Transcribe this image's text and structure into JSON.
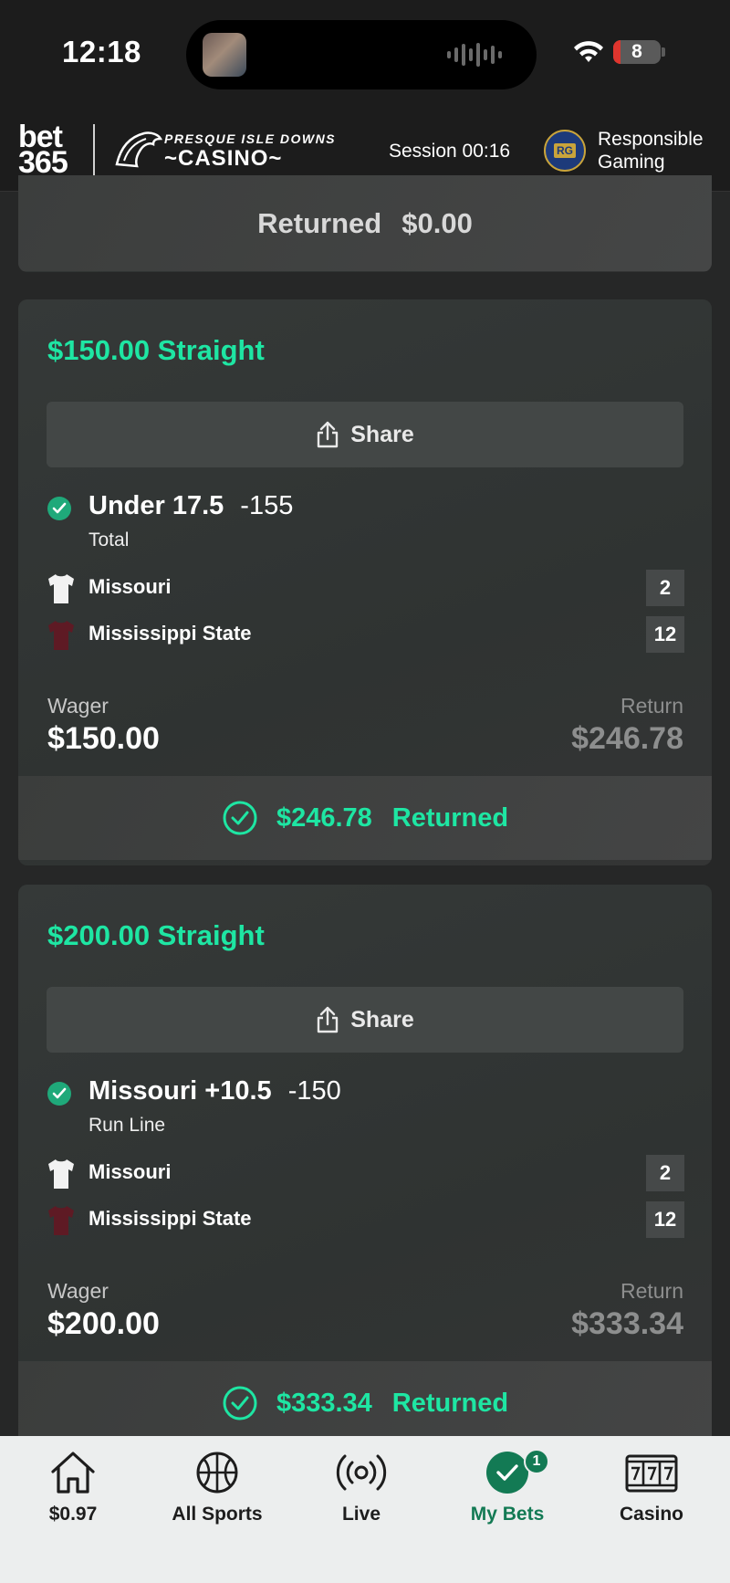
{
  "status_bar": {
    "time": "12:18",
    "battery_level": "8",
    "icons": [
      "wifi-icon",
      "battery-icon",
      "audio-waveform-icon"
    ]
  },
  "header": {
    "brand_line1": "bet",
    "brand_line2": "365",
    "casino_line1": "PRESQUE ISLE DOWNS",
    "casino_line2": "CASINO",
    "session": "Session 00:16",
    "rg_badge": "RG",
    "responsible_line1": "Responsible",
    "responsible_line2": "Gaming"
  },
  "previous_bet": {
    "returned_label": "Returned",
    "returned_amount": "$0.00"
  },
  "bets": [
    {
      "title": "$150.00 Straight",
      "share_label": "Share",
      "selection": "Under 17.5",
      "odds": "-155",
      "market": "Total",
      "teams": [
        {
          "name": "Missouri",
          "score": "2",
          "shirt_color": "#f2f2f2"
        },
        {
          "name": "Mississippi State",
          "score": "12",
          "shirt_color": "#5e1a24"
        }
      ],
      "wager_label": "Wager",
      "wager": "$150.00",
      "return_label": "Return",
      "return": "$246.78",
      "returned_amount": "$246.78",
      "returned_label": "Returned"
    },
    {
      "title": "$200.00 Straight",
      "share_label": "Share",
      "selection": "Missouri +10.5",
      "odds": "-150",
      "market": "Run Line",
      "teams": [
        {
          "name": "Missouri",
          "score": "2",
          "shirt_color": "#f2f2f2"
        },
        {
          "name": "Mississippi State",
          "score": "12",
          "shirt_color": "#5e1a24"
        }
      ],
      "wager_label": "Wager",
      "wager": "$200.00",
      "return_label": "Return",
      "return": "$333.34",
      "returned_amount": "$333.34",
      "returned_label": "Returned"
    }
  ],
  "tabbar": {
    "items": [
      {
        "label": "$0.97",
        "icon": "home-icon"
      },
      {
        "label": "All Sports",
        "icon": "basketball-icon"
      },
      {
        "label": "Live",
        "icon": "live-broadcast-icon"
      },
      {
        "label": "My Bets",
        "icon": "checkmark-icon",
        "badge": "1",
        "active": true
      },
      {
        "label": "Casino",
        "icon": "slot-machine-icon"
      }
    ]
  },
  "colors": {
    "accent_green": "#1ee6a3",
    "active_tab": "#137a54",
    "background": "#262727"
  }
}
